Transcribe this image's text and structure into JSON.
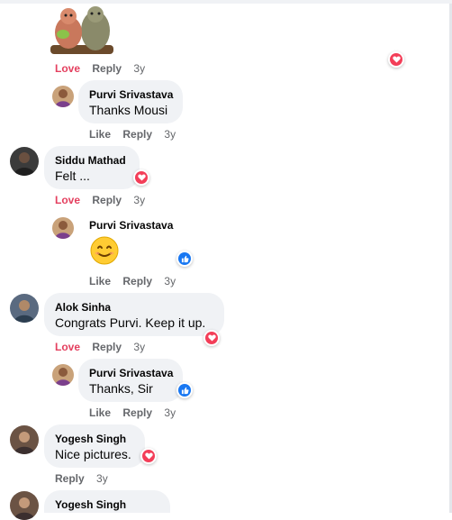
{
  "actions": {
    "love": "Love",
    "like": "Like",
    "reply": "Reply",
    "time": "3y"
  },
  "comments": [
    {
      "author": "",
      "text": "",
      "sticker": "bears-hug-sticker",
      "reaction": "love",
      "state": "loved"
    },
    {
      "author": "Purvi Srivastava",
      "text": "Thanks Mousi",
      "reply": true
    },
    {
      "author": "Siddu Mathad",
      "text": "Felt ...",
      "reaction": "love",
      "state": "loved"
    },
    {
      "author": "Purvi Srivastava",
      "text": "",
      "emoji": "smiling-face-emoji",
      "reaction": "like",
      "reply": true
    },
    {
      "author": "Alok Sinha",
      "text": "Congrats Purvi. Keep it up.",
      "reaction": "love",
      "state": "loved"
    },
    {
      "author": "Purvi Srivastava",
      "text": "Thanks, Sir",
      "reaction": "like",
      "reply": true
    },
    {
      "author": "Yogesh Singh",
      "text": "Nice pictures.",
      "reaction": "love",
      "state": "loved"
    },
    {
      "author": "Yogesh Singh",
      "text": ""
    }
  ],
  "colors": {
    "bubble": "#f0f2f5",
    "love": "#f33e58",
    "like": "#1877f2",
    "muted": "#65676b"
  }
}
